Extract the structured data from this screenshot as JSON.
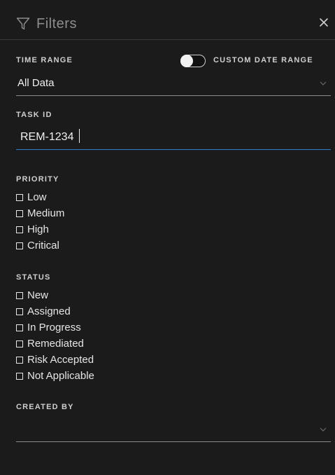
{
  "header": {
    "title": "Filters",
    "icon": "filter-icon",
    "close_icon": "close-icon"
  },
  "time_range": {
    "label": "TIME RANGE",
    "toggle_label": "CUSTOM DATE RANGE",
    "toggle_on": false,
    "value": "All Data"
  },
  "task_id": {
    "label": "TASK ID",
    "value": "REM-1234"
  },
  "priority": {
    "label": "PRIORITY",
    "options": [
      {
        "label": "Low",
        "checked": false
      },
      {
        "label": "Medium",
        "checked": false
      },
      {
        "label": "High",
        "checked": false
      },
      {
        "label": "Critical",
        "checked": false
      }
    ]
  },
  "status": {
    "label": "STATUS",
    "options": [
      {
        "label": "New",
        "checked": false
      },
      {
        "label": "Assigned",
        "checked": false
      },
      {
        "label": "In Progress",
        "checked": false
      },
      {
        "label": "Remediated",
        "checked": false
      },
      {
        "label": "Risk Accepted",
        "checked": false
      },
      {
        "label": "Not Applicable",
        "checked": false
      }
    ]
  },
  "created_by": {
    "label": "CREATED BY",
    "value": ""
  },
  "colors": {
    "background": "#1b1b1b",
    "focus_underline": "#2f7fd0",
    "text": "#e6e6e6"
  }
}
